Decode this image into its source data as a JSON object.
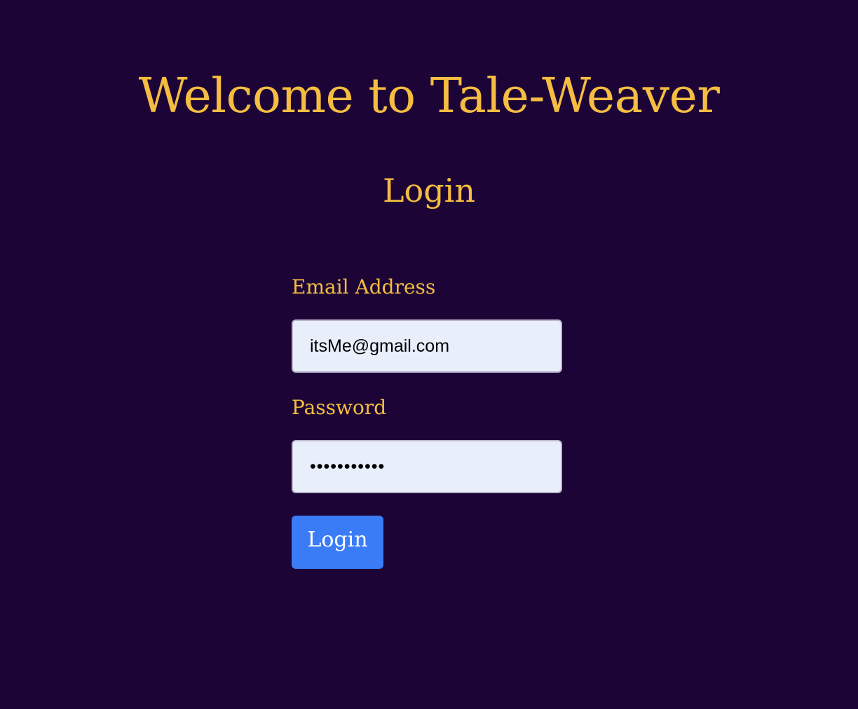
{
  "header": {
    "title": "Welcome to Tale-Weaver"
  },
  "login_form": {
    "heading": "Login",
    "email": {
      "label": "Email Address",
      "value": "itsMe@gmail.com"
    },
    "password": {
      "label": "Password",
      "value": "•••••••••••"
    },
    "submit_label": "Login"
  },
  "colors": {
    "background": "#1c0536",
    "accent_text": "#f5bd41",
    "input_background": "#e8eefa",
    "button_background": "#3a7cf6",
    "button_text": "#ffffff"
  }
}
